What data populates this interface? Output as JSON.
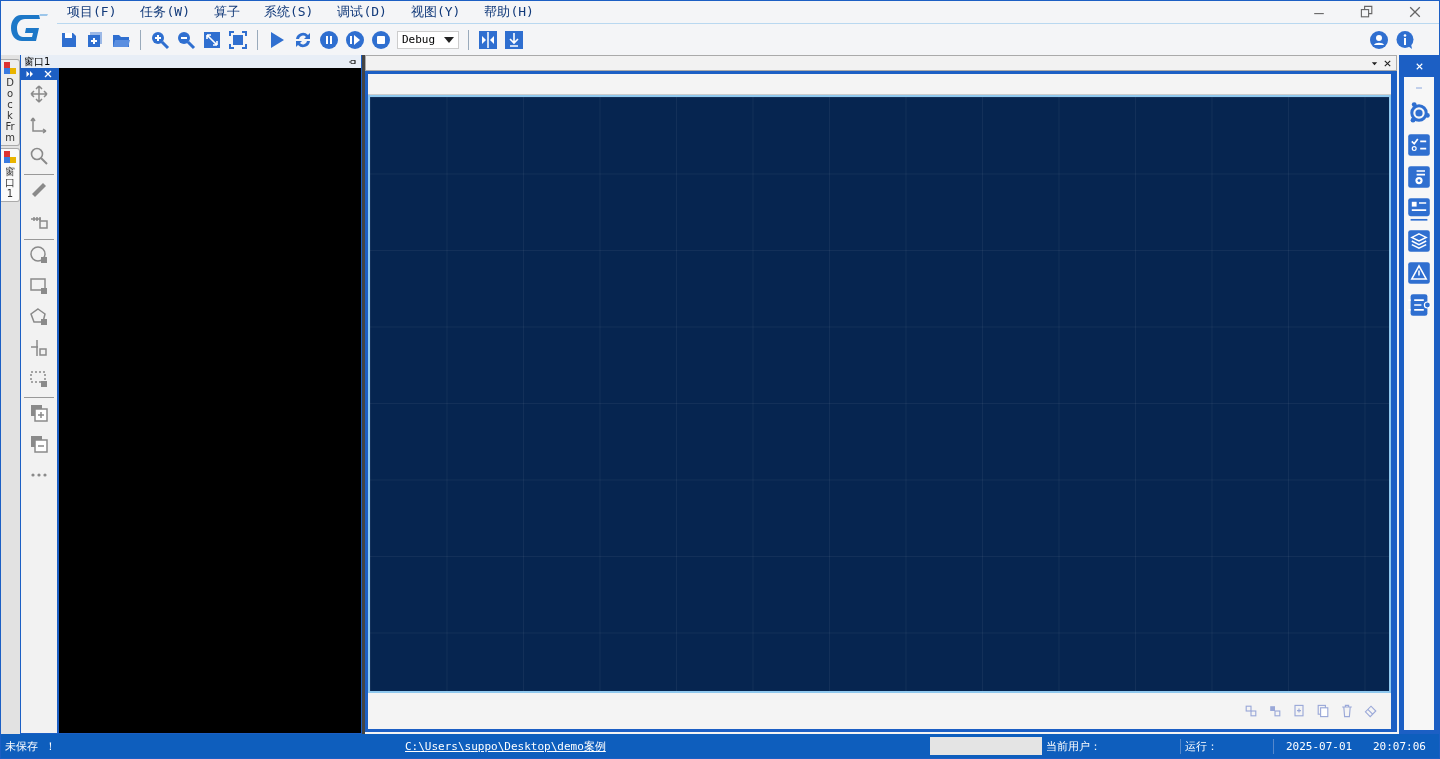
{
  "menu": [
    "项目(F)",
    "任务(W)",
    "算子",
    "系统(S)",
    "调试(D)",
    "视图(Y)",
    "帮助(H)"
  ],
  "toolbar": {
    "mode": "Debug"
  },
  "side_tabs": [
    {
      "label": "DockFrm",
      "selected": false
    },
    {
      "label": "窗口1",
      "selected": true
    }
  ],
  "dock": {
    "title": "窗口1"
  },
  "status_bar": {
    "message": "未保存 ！",
    "path": "C:\\Users\\suppo\\Desktop\\demo案例",
    "user_label": "当前用户：",
    "run_label": "运行：",
    "date": "2025-07-01",
    "time": "20:07:06"
  }
}
